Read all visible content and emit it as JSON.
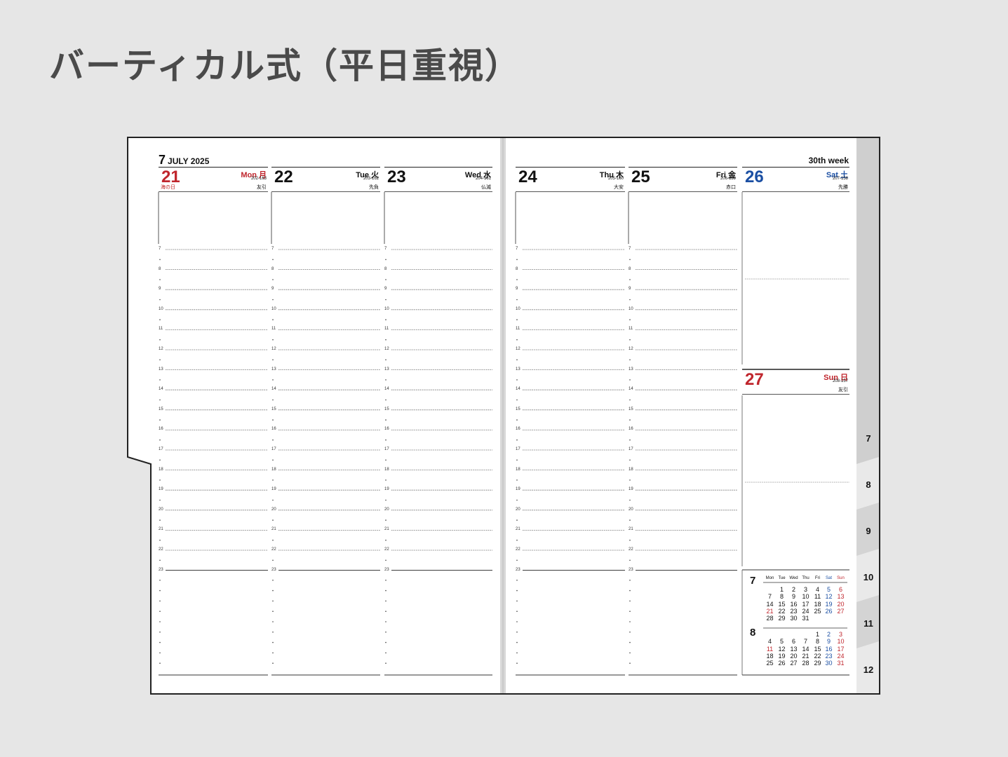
{
  "title": "バーティカル式（平日重視）",
  "month_label": {
    "month": "7",
    "rest": "JULY  2025"
  },
  "week_label": "30th week",
  "days": [
    {
      "num": "21",
      "name": "Mon 月",
      "count": "202-163",
      "sub": "友引",
      "holiday": "海の日",
      "color": "red"
    },
    {
      "num": "22",
      "name": "Tue 火",
      "count": "203-162",
      "sub": "先負",
      "holiday": "",
      "color": "black"
    },
    {
      "num": "23",
      "name": "Wed 水",
      "count": "204-161",
      "sub": "仏滅",
      "holiday": "",
      "color": "black"
    },
    {
      "num": "24",
      "name": "Thu 木",
      "count": "205-160",
      "sub": "大安",
      "holiday": "",
      "color": "black"
    },
    {
      "num": "25",
      "name": "Fri 金",
      "count": "206-159",
      "sub": "赤口",
      "holiday": "",
      "color": "black"
    },
    {
      "num": "26",
      "name": "Sat 土",
      "count": "207-158",
      "sub": "先勝",
      "holiday": "",
      "color": "blue"
    },
    {
      "num": "27",
      "name": "Sun 日",
      "count": "208-157",
      "sub": "友引",
      "holiday": "",
      "color": "red"
    }
  ],
  "hours": [
    "7",
    "8",
    "9",
    "10",
    "11",
    "12",
    "13",
    "14",
    "15",
    "16",
    "17",
    "18",
    "19",
    "20",
    "21",
    "22",
    "23"
  ],
  "tabs": [
    "7",
    "8",
    "9",
    "10",
    "11",
    "12"
  ],
  "weekday_heads": [
    "Mon",
    "Tue",
    "Wed",
    "Thu",
    "Fri",
    "Sat",
    "Sun"
  ],
  "mini_calendars": [
    {
      "month": "7",
      "weeks": [
        [
          "",
          "1",
          "2",
          "3",
          "4",
          "5",
          "6"
        ],
        [
          "7",
          "8",
          "9",
          "10",
          "11",
          "12",
          "13"
        ],
        [
          "14",
          "15",
          "16",
          "17",
          "18",
          "19",
          "20"
        ],
        [
          "21",
          "22",
          "23",
          "24",
          "25",
          "26",
          "27"
        ],
        [
          "28",
          "29",
          "30",
          "31",
          "",
          "",
          ""
        ]
      ]
    },
    {
      "month": "8",
      "weeks": [
        [
          "",
          "",
          "",
          "",
          "1",
          "2",
          "3"
        ],
        [
          "4",
          "5",
          "6",
          "7",
          "8",
          "9",
          "10"
        ],
        [
          "11",
          "12",
          "13",
          "14",
          "15",
          "16",
          "17"
        ],
        [
          "18",
          "19",
          "20",
          "21",
          "22",
          "23",
          "24"
        ],
        [
          "25",
          "26",
          "27",
          "28",
          "29",
          "30",
          "31"
        ]
      ]
    }
  ],
  "colors": {
    "background": "#e6e6e6",
    "red": "#c0262d",
    "blue": "#1b4fa3",
    "title": "#4a4a4a"
  }
}
